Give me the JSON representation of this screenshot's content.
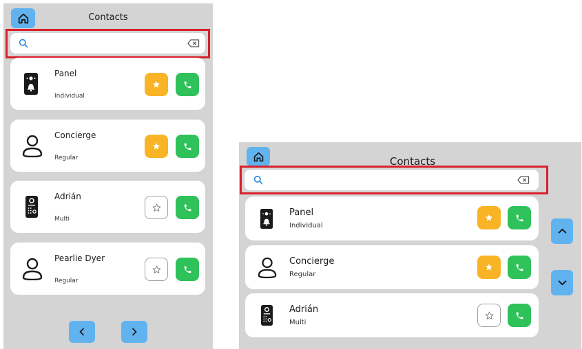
{
  "left": {
    "title": "Contacts",
    "contacts": [
      {
        "name": "Panel",
        "type": "Individual",
        "icon": "door-panel-icon",
        "favorite": true
      },
      {
        "name": "Concierge",
        "type": "Regular",
        "icon": "person-icon",
        "favorite": true
      },
      {
        "name": "Adrián",
        "type": "Multi",
        "icon": "intercom-keypad-icon",
        "favorite": false
      },
      {
        "name": "Pearlie Dyer",
        "type": "Regular",
        "icon": "person-icon",
        "favorite": false
      }
    ]
  },
  "right": {
    "title": "Contacts",
    "contacts": [
      {
        "name": "Panel",
        "type": "Individual",
        "icon": "door-panel-icon",
        "favorite": true
      },
      {
        "name": "Concierge",
        "type": "Regular",
        "icon": "person-icon",
        "favorite": true
      },
      {
        "name": "Adrián",
        "type": "Multi",
        "icon": "intercom-keypad-icon",
        "favorite": false
      }
    ]
  },
  "colors": {
    "accent_blue": "#61b3f0",
    "favorite_yellow": "#f8b424",
    "call_green": "#2fc15a",
    "highlight_red": "#d8202a",
    "panel_gray": "#d4d4d4"
  }
}
